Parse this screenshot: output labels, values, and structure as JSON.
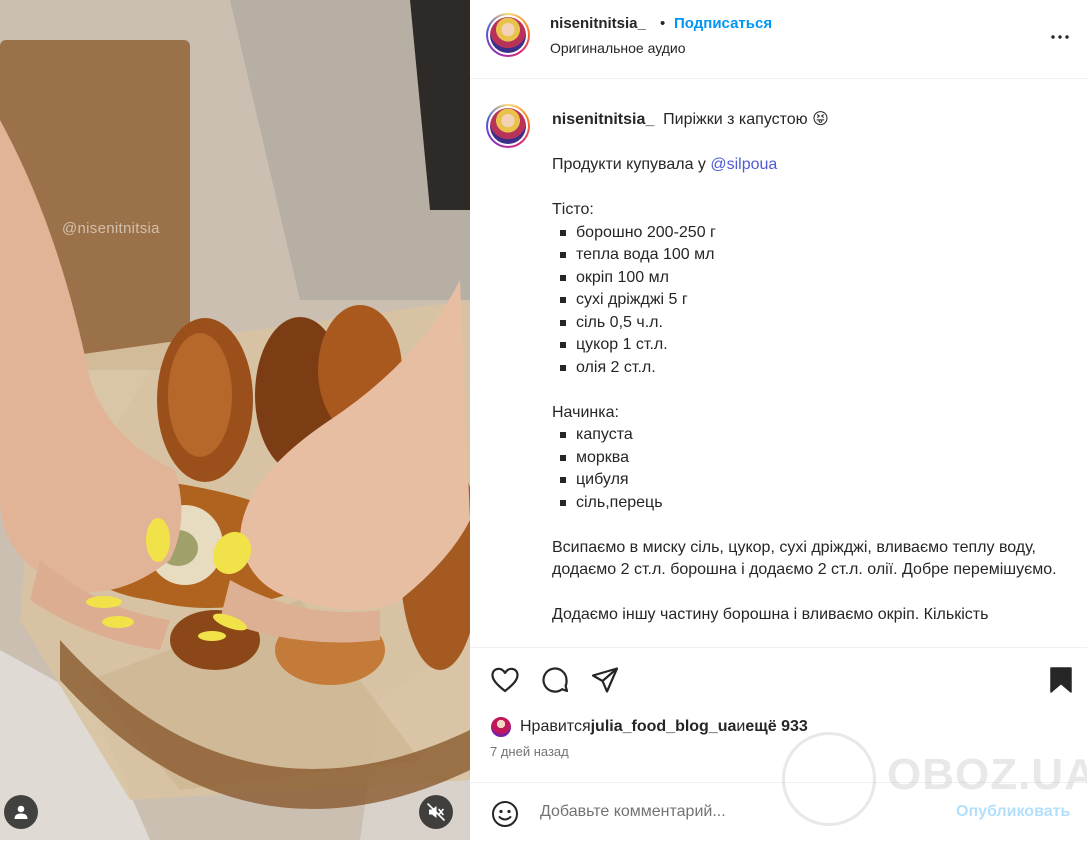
{
  "media": {
    "watermark": "@nisenitnitsia",
    "user_button_icon": "user-icon",
    "mute_button_icon": "muted-speaker-icon"
  },
  "header": {
    "username": "nisenitnitsia_",
    "separator": "•",
    "follow_label": "Подписаться",
    "audio_label": "Оригинальное аудио",
    "more_icon": "more-horizontal-icon"
  },
  "caption": {
    "username": "nisenitnitsia_",
    "title": "Пиріжки з капустою 😝",
    "intro_prefix": "Продукти купувала у ",
    "intro_mention": "@silpoua",
    "dough_heading": "Тісто:",
    "dough_items": [
      "борошно 200-250 г",
      "тепла вода 100 мл",
      "окріп 100 мл",
      "сухі дріжджі 5 г",
      "сіль 0,5 ч.л.",
      "цукор 1 ст.л.",
      "олія 2 ст.л."
    ],
    "filling_heading": "Начинка:",
    "filling_items": [
      "капуста",
      "морква",
      "цибуля",
      "сіль,перець"
    ],
    "step1": "Всипаємо в миску сіль, цукор, сухі дріжджі, вливаємо теплу воду, додаємо 2 ст.л. борошна і додаємо 2 ст.л. олії. Добре перемішуємо.",
    "step2": "Додаємо іншу частину борошна і вливаємо окріп. Кількість"
  },
  "actions": {
    "like_icon": "heart-icon",
    "comment_icon": "comment-icon",
    "share_icon": "send-icon",
    "save_icon": "bookmark-filled-icon"
  },
  "likes": {
    "prefix": "Нравится ",
    "user": "julia_food_blog_ua",
    "middle": " и ",
    "others": "ещё 933"
  },
  "posted": "7 дней назад",
  "comment": {
    "emoji_icon": "smiley-icon",
    "placeholder": "Добавьте комментарий...",
    "publish_label": "Опубликовать"
  },
  "site_watermark": "OBOZ.UA",
  "colors": {
    "link_blue": "#0095f6",
    "mention": "#4e5ad6",
    "publish_disabled": "#b2dffc",
    "secondary_text": "#737373"
  }
}
